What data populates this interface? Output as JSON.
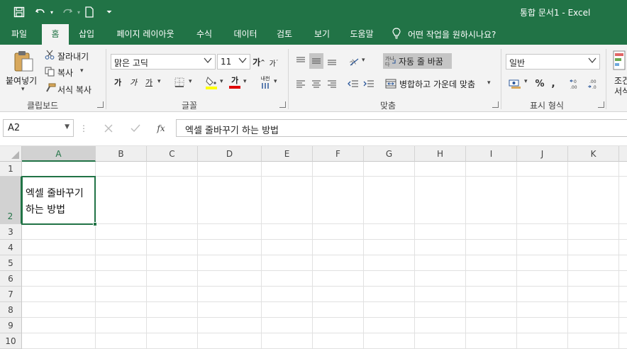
{
  "window": {
    "title": "통합 문서1  -  Excel"
  },
  "quick_access": [
    {
      "name": "save-icon"
    },
    {
      "name": "undo-icon"
    },
    {
      "name": "redo-icon"
    },
    {
      "name": "new-file-icon"
    },
    {
      "name": "customize-qat-icon"
    }
  ],
  "tabs": [
    "파일",
    "홈",
    "삽입",
    "페이지 레이아웃",
    "수식",
    "데이터",
    "검토",
    "보기",
    "도움말"
  ],
  "active_tab": "홈",
  "tell_me": "어떤 작업을 원하시나요?",
  "clipboard": {
    "paste": "붙여넣기",
    "cut": "잘라내기",
    "copy": "복사",
    "format_painter": "서식 복사",
    "group": "클립보드"
  },
  "font": {
    "name": "맑은 고딕",
    "size": "11",
    "bold": "가",
    "italic": "가",
    "underline": "가",
    "font_color_glyph": "가",
    "phonetic": "내천",
    "group": "글꼴"
  },
  "alignment": {
    "wrap_text": "자동 줄 바꿈",
    "merge_center": "병합하고 가운데 맞춤",
    "group": "맞춤"
  },
  "number": {
    "format": "일반",
    "percent": "%",
    "group": "표시 형식"
  },
  "styles": {
    "conditional_top": "조건",
    "conditional_bottom": "서식"
  },
  "formula_bar": {
    "name_box": "A2",
    "content": "엑셀 줄바꾸기 하는 방법",
    "fx": "fx"
  },
  "sheet": {
    "columns": [
      "A",
      "B",
      "C",
      "D",
      "E",
      "F",
      "G",
      "H",
      "I",
      "J",
      "K"
    ],
    "rows": [
      "1",
      "2",
      "3",
      "4",
      "5",
      "6",
      "7",
      "8",
      "9",
      "10"
    ],
    "selected_cell": "A2",
    "cell_a2": "엑셀 줄바꾸기\n하는 방법"
  },
  "colors": {
    "accent": "#217346",
    "font_color": "#e00000",
    "highlight": "#ffff00"
  }
}
